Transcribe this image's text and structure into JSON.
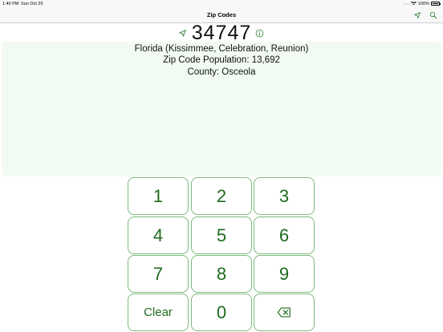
{
  "status_bar": {
    "time": "1:40 PM",
    "date": "Sun Oct 20",
    "battery": "100%",
    "signal": "••••"
  },
  "nav": {
    "title": "Zip Codes",
    "location_icon": "location-arrow-icon",
    "search_icon": "search-icon"
  },
  "zip": {
    "value": "34747",
    "arrow_icon": "location-arrow-icon",
    "info_icon": "info-icon"
  },
  "info": {
    "line1": "Florida (Kissimmee, Celebration, Reunion)",
    "line2": "Zip Code Population: 13,692",
    "line3": "County: Osceola"
  },
  "keypad": {
    "k1": "1",
    "k2": "2",
    "k3": "3",
    "k4": "4",
    "k5": "5",
    "k6": "6",
    "k7": "7",
    "k8": "8",
    "k9": "9",
    "clear": "Clear",
    "k0": "0",
    "backspace_icon": "backspace-icon"
  },
  "colors": {
    "accent": "#1f6b1f",
    "key_border": "#7dba7d",
    "panel_bg": "#f2fbf2"
  }
}
